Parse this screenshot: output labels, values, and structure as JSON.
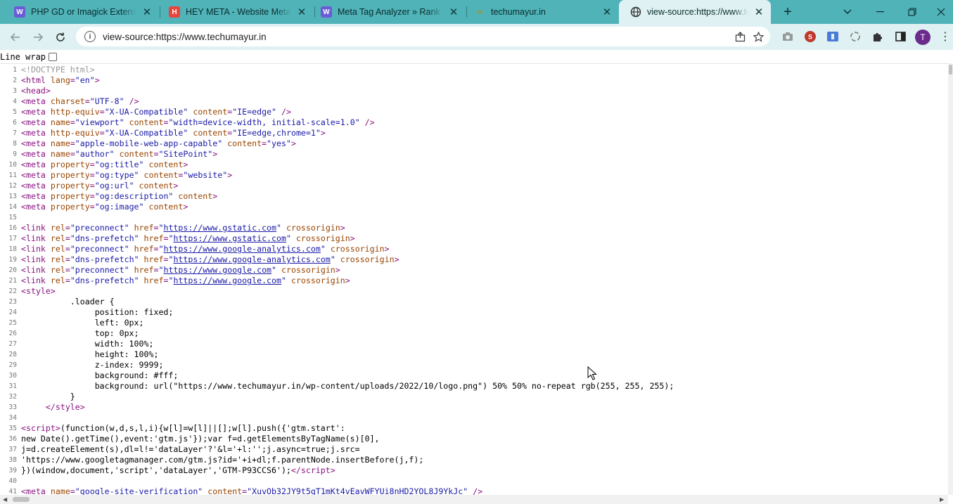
{
  "tabs": [
    {
      "title": "PHP GD or Imagick Extension",
      "favicon": "wordpress-icon",
      "color": "#6b5bd6"
    },
    {
      "title": "HEY META - Website Meta Ta",
      "favicon": "h-icon",
      "color": "#e8453c"
    },
    {
      "title": "Meta Tag Analyzer » Rank Ma",
      "favicon": "wordpress-icon",
      "color": "#6b5bd6"
    },
    {
      "title": "techumayur.in",
      "favicon": "site-icon",
      "color": "#e0a800"
    },
    {
      "title": "view-source:https://www.tec",
      "favicon": "globe-icon",
      "color": "#333333"
    }
  ],
  "toolbar": {
    "url": "view-source:https://www.techumayur.in",
    "avatar_letter": "T"
  },
  "linewrap": {
    "label": "Line wrap"
  },
  "source_lines": [
    {
      "n": "1",
      "html": "<span class='doctype'>&lt;!DOCTYPE html&gt;</span>"
    },
    {
      "n": "2",
      "html": "<span class='tag'>&lt;html </span><span class='attr'>lang</span><span class='tag'>=</span><span class='val'>\"en\"</span><span class='tag'>&gt;</span>"
    },
    {
      "n": "3",
      "html": "<span class='tag'>&lt;head&gt;</span>"
    },
    {
      "n": "4",
      "html": "<span class='tag'>&lt;meta </span><span class='attr'>charset</span><span class='tag'>=</span><span class='val'>\"UTF-8\"</span><span class='tag'> /&gt;</span>"
    },
    {
      "n": "5",
      "html": "<span class='tag'>&lt;meta </span><span class='attr'>http-equiv</span><span class='tag'>=</span><span class='val'>\"X-UA-Compatible\"</span><span class='tag'> </span><span class='attr'>content</span><span class='tag'>=</span><span class='val'>\"IE=edge\"</span><span class='tag'> /&gt;</span>"
    },
    {
      "n": "6",
      "html": "<span class='tag'>&lt;meta </span><span class='attr'>name</span><span class='tag'>=</span><span class='val'>\"viewport\"</span><span class='tag'> </span><span class='attr'>content</span><span class='tag'>=</span><span class='val'>\"width=device-width, initial-scale=1.0\"</span><span class='tag'> /&gt;</span>"
    },
    {
      "n": "7",
      "html": "<span class='tag'>&lt;meta </span><span class='attr'>http-equiv</span><span class='tag'>=</span><span class='val'>\"X-UA-Compatible\"</span><span class='tag'> </span><span class='attr'>content</span><span class='tag'>=</span><span class='val'>\"IE=edge,chrome=1\"</span><span class='tag'>&gt;</span>"
    },
    {
      "n": "8",
      "html": "<span class='tag'>&lt;meta </span><span class='attr'>name</span><span class='tag'>=</span><span class='val'>\"apple-mobile-web-app-capable\"</span><span class='tag'> </span><span class='attr'>content</span><span class='tag'>=</span><span class='val'>\"yes\"</span><span class='tag'>&gt;</span>"
    },
    {
      "n": "9",
      "html": "<span class='tag'>&lt;meta </span><span class='attr'>name</span><span class='tag'>=</span><span class='val'>\"author\"</span><span class='tag'> </span><span class='attr'>content</span><span class='tag'>=</span><span class='val'>\"SitePoint\"</span><span class='tag'>&gt;</span>"
    },
    {
      "n": "10",
      "html": "<span class='tag'>&lt;meta </span><span class='attr'>property</span><span class='tag'>=</span><span class='val'>\"og:title\"</span><span class='tag'> </span><span class='attr'>content</span><span class='tag'>&gt;</span>"
    },
    {
      "n": "11",
      "html": "<span class='tag'>&lt;meta </span><span class='attr'>property</span><span class='tag'>=</span><span class='val'>\"og:type\"</span><span class='tag'> </span><span class='attr'>content</span><span class='tag'>=</span><span class='val'>\"website\"</span><span class='tag'>&gt;</span>"
    },
    {
      "n": "12",
      "html": "<span class='tag'>&lt;meta </span><span class='attr'>property</span><span class='tag'>=</span><span class='val'>\"og:url\"</span><span class='tag'> </span><span class='attr'>content</span><span class='tag'>&gt;</span>"
    },
    {
      "n": "13",
      "html": "<span class='tag'>&lt;meta </span><span class='attr'>property</span><span class='tag'>=</span><span class='val'>\"og:description\"</span><span class='tag'> </span><span class='attr'>content</span><span class='tag'>&gt;</span>"
    },
    {
      "n": "14",
      "html": "<span class='tag'>&lt;meta </span><span class='attr'>property</span><span class='tag'>=</span><span class='val'>\"og:image\"</span><span class='tag'> </span><span class='attr'>content</span><span class='tag'>&gt;</span>"
    },
    {
      "n": "15",
      "html": ""
    },
    {
      "n": "16",
      "html": "<span class='tag'>&lt;link </span><span class='attr'>rel</span><span class='tag'>=</span><span class='val'>\"preconnect\"</span><span class='tag'> </span><span class='attr'>href</span><span class='tag'>=</span><span class='val'>\"<span class='link'>https://www.gstatic.com</span>\"</span><span class='tag'> </span><span class='attr'>crossorigin</span><span class='tag'>&gt;</span>"
    },
    {
      "n": "17",
      "html": "<span class='tag'>&lt;link </span><span class='attr'>rel</span><span class='tag'>=</span><span class='val'>\"dns-prefetch\"</span><span class='tag'> </span><span class='attr'>href</span><span class='tag'>=</span><span class='val'>\"<span class='link'>https://www.gstatic.com</span>\"</span><span class='tag'> </span><span class='attr'>crossorigin</span><span class='tag'>&gt;</span>"
    },
    {
      "n": "18",
      "html": "<span class='tag'>&lt;link </span><span class='attr'>rel</span><span class='tag'>=</span><span class='val'>\"preconnect\"</span><span class='tag'> </span><span class='attr'>href</span><span class='tag'>=</span><span class='val'>\"<span class='link'>https://www.google-analytics.com</span>\"</span><span class='tag'> </span><span class='attr'>crossorigin</span><span class='tag'>&gt;</span>"
    },
    {
      "n": "19",
      "html": "<span class='tag'>&lt;link </span><span class='attr'>rel</span><span class='tag'>=</span><span class='val'>\"dns-prefetch\"</span><span class='tag'> </span><span class='attr'>href</span><span class='tag'>=</span><span class='val'>\"<span class='link'>https://www.google-analytics.com</span>\"</span><span class='tag'> </span><span class='attr'>crossorigin</span><span class='tag'>&gt;</span>"
    },
    {
      "n": "20",
      "html": "<span class='tag'>&lt;link </span><span class='attr'>rel</span><span class='tag'>=</span><span class='val'>\"preconnect\"</span><span class='tag'> </span><span class='attr'>href</span><span class='tag'>=</span><span class='val'>\"<span class='link'>https://www.google.com</span>\"</span><span class='tag'> </span><span class='attr'>crossorigin</span><span class='tag'>&gt;</span>"
    },
    {
      "n": "21",
      "html": "<span class='tag'>&lt;link </span><span class='attr'>rel</span><span class='tag'>=</span><span class='val'>\"dns-prefetch\"</span><span class='tag'> </span><span class='attr'>href</span><span class='tag'>=</span><span class='val'>\"<span class='link'>https://www.google.com</span>\"</span><span class='tag'> </span><span class='attr'>crossorigin</span><span class='tag'>&gt;</span>"
    },
    {
      "n": "22",
      "html": "<span class='tag'>&lt;style&gt;</span>"
    },
    {
      "n": "23",
      "html": "<span class='css'>          .loader {</span>"
    },
    {
      "n": "24",
      "html": "<span class='css'>               position: fixed;</span>"
    },
    {
      "n": "25",
      "html": "<span class='css'>               left: 0px;</span>"
    },
    {
      "n": "26",
      "html": "<span class='css'>               top: 0px;</span>"
    },
    {
      "n": "27",
      "html": "<span class='css'>               width: 100%;</span>"
    },
    {
      "n": "28",
      "html": "<span class='css'>               height: 100%;</span>"
    },
    {
      "n": "29",
      "html": "<span class='css'>               z-index: 9999;</span>"
    },
    {
      "n": "30",
      "html": "<span class='css'>               background: #fff;</span>"
    },
    {
      "n": "31",
      "html": "<span class='css'>               background: url(\"https://www.techumayur.in/wp-content/uploads/2022/10/logo.png\") 50% 50% no-repeat rgb(255, 255, 255);</span>"
    },
    {
      "n": "32",
      "html": "<span class='css'>          }</span>"
    },
    {
      "n": "33",
      "html": "<span class='css'>     </span><span class='tag'>&lt;/style&gt;</span>"
    },
    {
      "n": "34",
      "html": ""
    },
    {
      "n": "35",
      "html": "<span class='tag'>&lt;script&gt;</span><span class='css'>(function(w,d,s,l,i){w[l]=w[l]||[];w[l].push({'gtm.start':</span>"
    },
    {
      "n": "36",
      "html": "<span class='css'>new Date().getTime(),event:'gtm.js'});var f=d.getElementsByTagName(s)[0],</span>"
    },
    {
      "n": "37",
      "html": "<span class='css'>j=d.createElement(s),dl=l!='dataLayer'?'&amp;l='+l:'';j.async=true;j.src=</span>"
    },
    {
      "n": "38",
      "html": "<span class='css'>'https://www.googletagmanager.com/gtm.js?id='+i+dl;f.parentNode.insertBefore(j,f);</span>"
    },
    {
      "n": "39",
      "html": "<span class='css'>})(window,document,'script','dataLayer','GTM-P93CCS6');</span><span class='tag'>&lt;/script&gt;</span>"
    },
    {
      "n": "40",
      "html": ""
    },
    {
      "n": "41",
      "html": "<span class='tag'>&lt;meta </span><span class='attr'>name</span><span class='tag'>=</span><span class='val'>\"google-site-verification\"</span><span class='tag'> </span><span class='attr'>content</span><span class='tag'>=</span><span class='val'>\"XuvOb32JY9t5gT1mKt4vEavWFYUi8nHD2YOL8J9YkJc\"</span><span class='tag'> /&gt;</span>"
    }
  ]
}
